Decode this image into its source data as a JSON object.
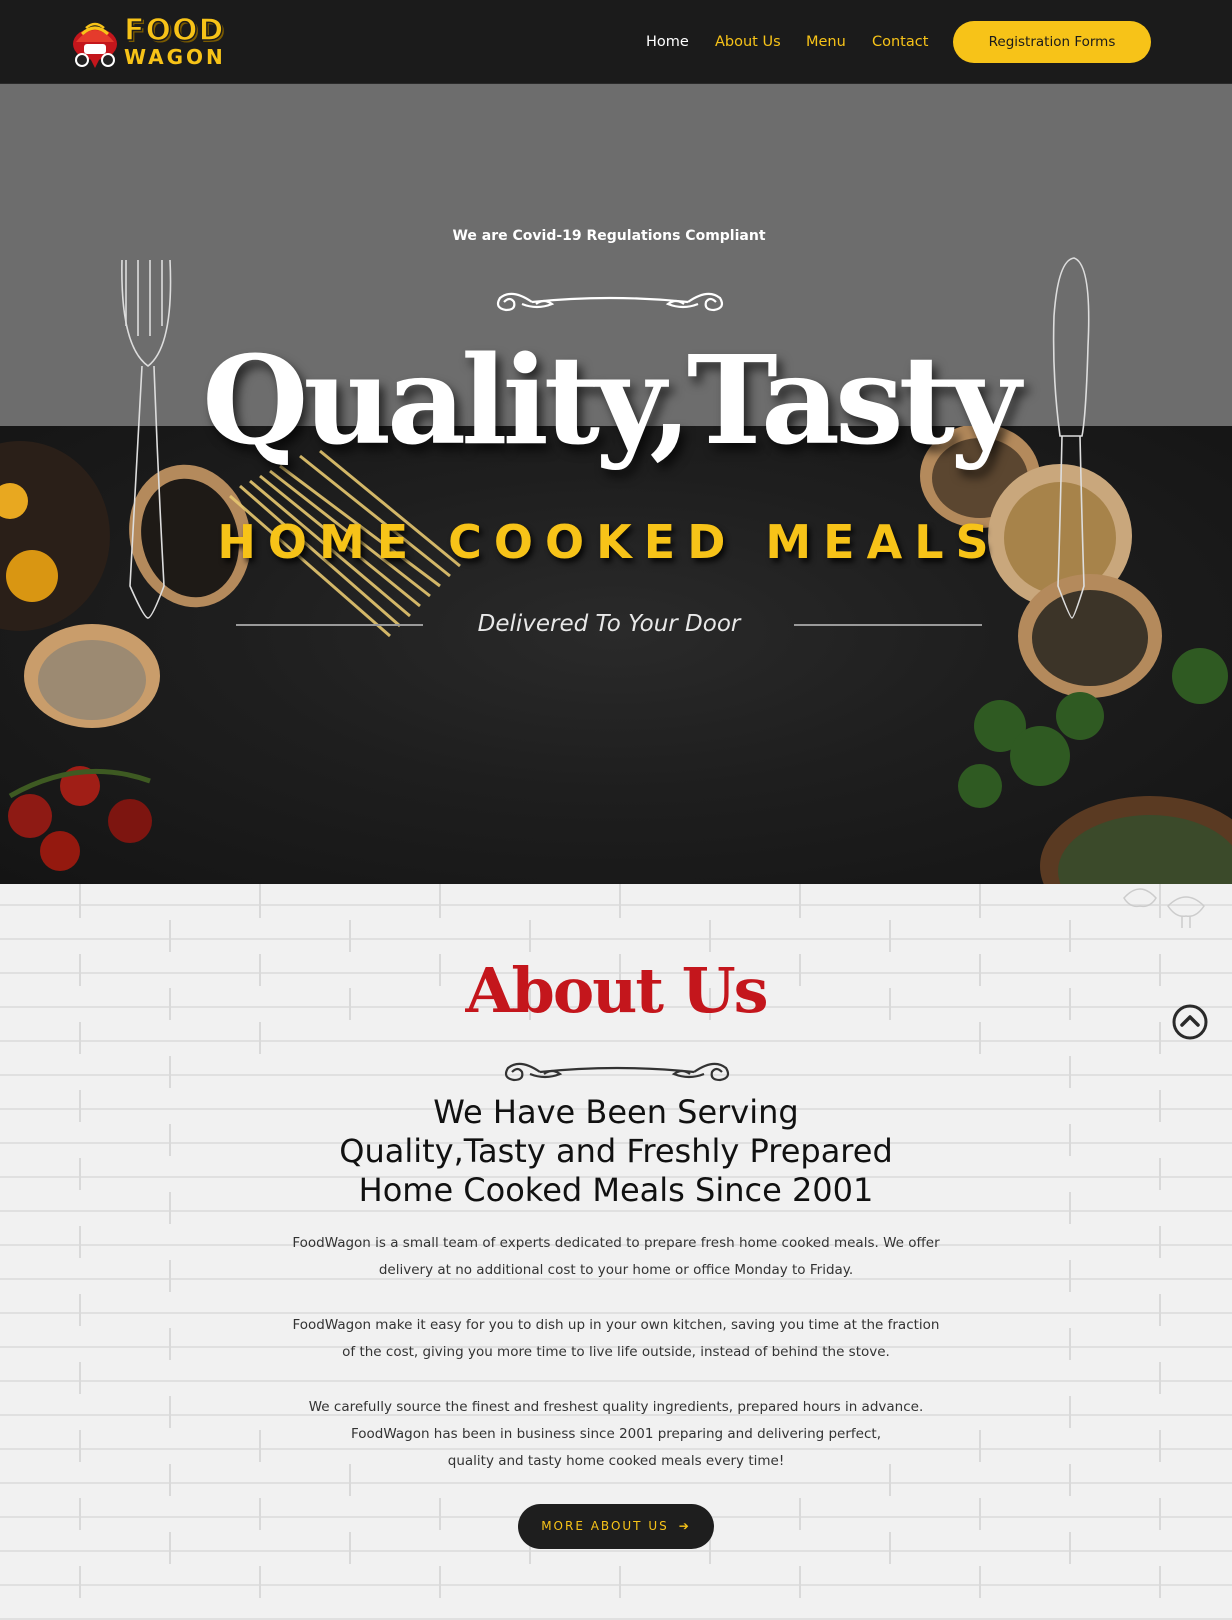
{
  "header": {
    "logo": {
      "top_text": "FOOD",
      "bottom_text": "WAGON"
    },
    "nav": [
      {
        "label": "Home",
        "active": true
      },
      {
        "label": "About Us"
      },
      {
        "label": "Menu"
      },
      {
        "label": "Contact"
      }
    ],
    "cta_label": "Registration Forms"
  },
  "hero": {
    "notice": "We are Covid-19 Regulations Compliant",
    "headline": "Quality,Tasty",
    "subheadline": "HOME COOKED MEALS",
    "tagline": "Delivered To Your Door"
  },
  "about": {
    "title": "About Us",
    "heading_lines": [
      "We Have Been Serving",
      "Quality,Tasty and Freshly Prepared",
      "Home Cooked Meals Since 2001"
    ],
    "paragraphs": [
      [
        "FoodWagon is a small team of experts dedicated to prepare fresh home cooked meals. We offer",
        "delivery at no additional cost to your home or office Monday to Friday."
      ],
      [
        "FoodWagon make it easy for you to dish up in your own kitchen, saving you time at the fraction",
        "of the cost, giving you more time to live life outside, instead of behind the stove."
      ],
      [
        "We carefully source the finest and freshest quality ingredients, prepared hours in advance.",
        "FoodWagon has been in business since 2001 preparing and delivering perfect,",
        "quality and tasty home cooked meals every time!"
      ]
    ],
    "button_label": "MORE ABOUT US"
  },
  "colors": {
    "header_bg": "#1b1b1b",
    "accent_yellow": "#f7c318",
    "about_title_red": "#c4161c",
    "hero_grey": "#6d6d6d"
  },
  "icons": {
    "logo": "food-wagon-logo",
    "arrow": "arrow-right-icon",
    "scroll_top": "chevron-up-circle-icon",
    "fork": "fork-illustration",
    "knife": "knife-illustration"
  }
}
